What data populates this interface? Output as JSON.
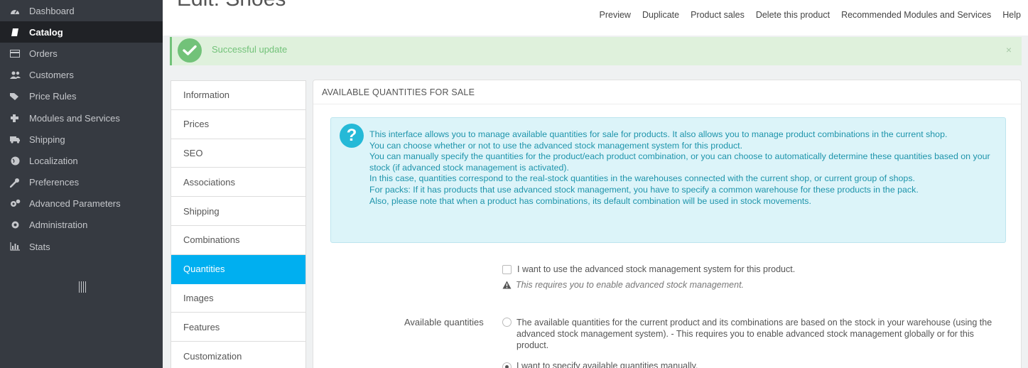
{
  "sidebar": {
    "items": [
      {
        "label": "Dashboard",
        "icon": "dashboard-icon"
      },
      {
        "label": "Catalog",
        "icon": "book-icon"
      },
      {
        "label": "Orders",
        "icon": "credit-card-icon"
      },
      {
        "label": "Customers",
        "icon": "users-icon"
      },
      {
        "label": "Price Rules",
        "icon": "tags-icon"
      },
      {
        "label": "Modules and Services",
        "icon": "puzzle-icon"
      },
      {
        "label": "Shipping",
        "icon": "truck-icon"
      },
      {
        "label": "Localization",
        "icon": "globe-icon"
      },
      {
        "label": "Preferences",
        "icon": "wrench-icon"
      },
      {
        "label": "Advanced Parameters",
        "icon": "cogs-icon"
      },
      {
        "label": "Administration",
        "icon": "cog-icon"
      },
      {
        "label": "Stats",
        "icon": "bar-chart-icon"
      }
    ],
    "active_index": 1
  },
  "header": {
    "title": "Edit: Shoes",
    "toolbar": [
      "Preview",
      "Duplicate",
      "Product sales",
      "Delete this product",
      "Recommended Modules and Services",
      "Help"
    ]
  },
  "alert": {
    "text": "Successful update",
    "close": "×"
  },
  "tabs": {
    "items": [
      "Information",
      "Prices",
      "SEO",
      "Associations",
      "Shipping",
      "Combinations",
      "Quantities",
      "Images",
      "Features",
      "Customization"
    ],
    "active_index": 6
  },
  "panel": {
    "heading": "AVAILABLE QUANTITIES FOR SALE",
    "info_icon": "?",
    "info_lines": [
      "This interface allows you to manage available quantities for sale for products. It also allows you to manage product combinations in the current shop.",
      "You can choose whether or not to use the advanced stock management system for this product.",
      "You can manually specify the quantities for the product/each product combination, or you can choose to automatically determine these quantities based on your stock (if advanced stock management is activated).",
      "In this case, quantities correspond to the real-stock quantities in the warehouses connected with the current shop, or current group of shops.",
      "For packs: If it has products that use advanced stock management, you have to specify a common warehouse for these products in the pack.",
      "Also, please note that when a product has combinations, its default combination will be used in stock movements."
    ],
    "advanced_checkbox_label": "I want to use the advanced stock management system for this product.",
    "advanced_help": "This requires you to enable advanced stock management.",
    "available_label": "Available quantities",
    "radio_asm_label": "The available quantities for the current product and its combinations are based on the stock in your warehouse (using the advanced stock management system).  - This requires you to enable advanced stock management globally or for this product.",
    "radio_manual_label": "I want to specify available quantities manually."
  },
  "colors": {
    "sidebar_bg": "#363a41",
    "sidebar_active": "#202226",
    "accent": "#00aff0",
    "success": "#72c279",
    "info_bg": "#dcf4f9",
    "info_text": "#1e94ab"
  }
}
